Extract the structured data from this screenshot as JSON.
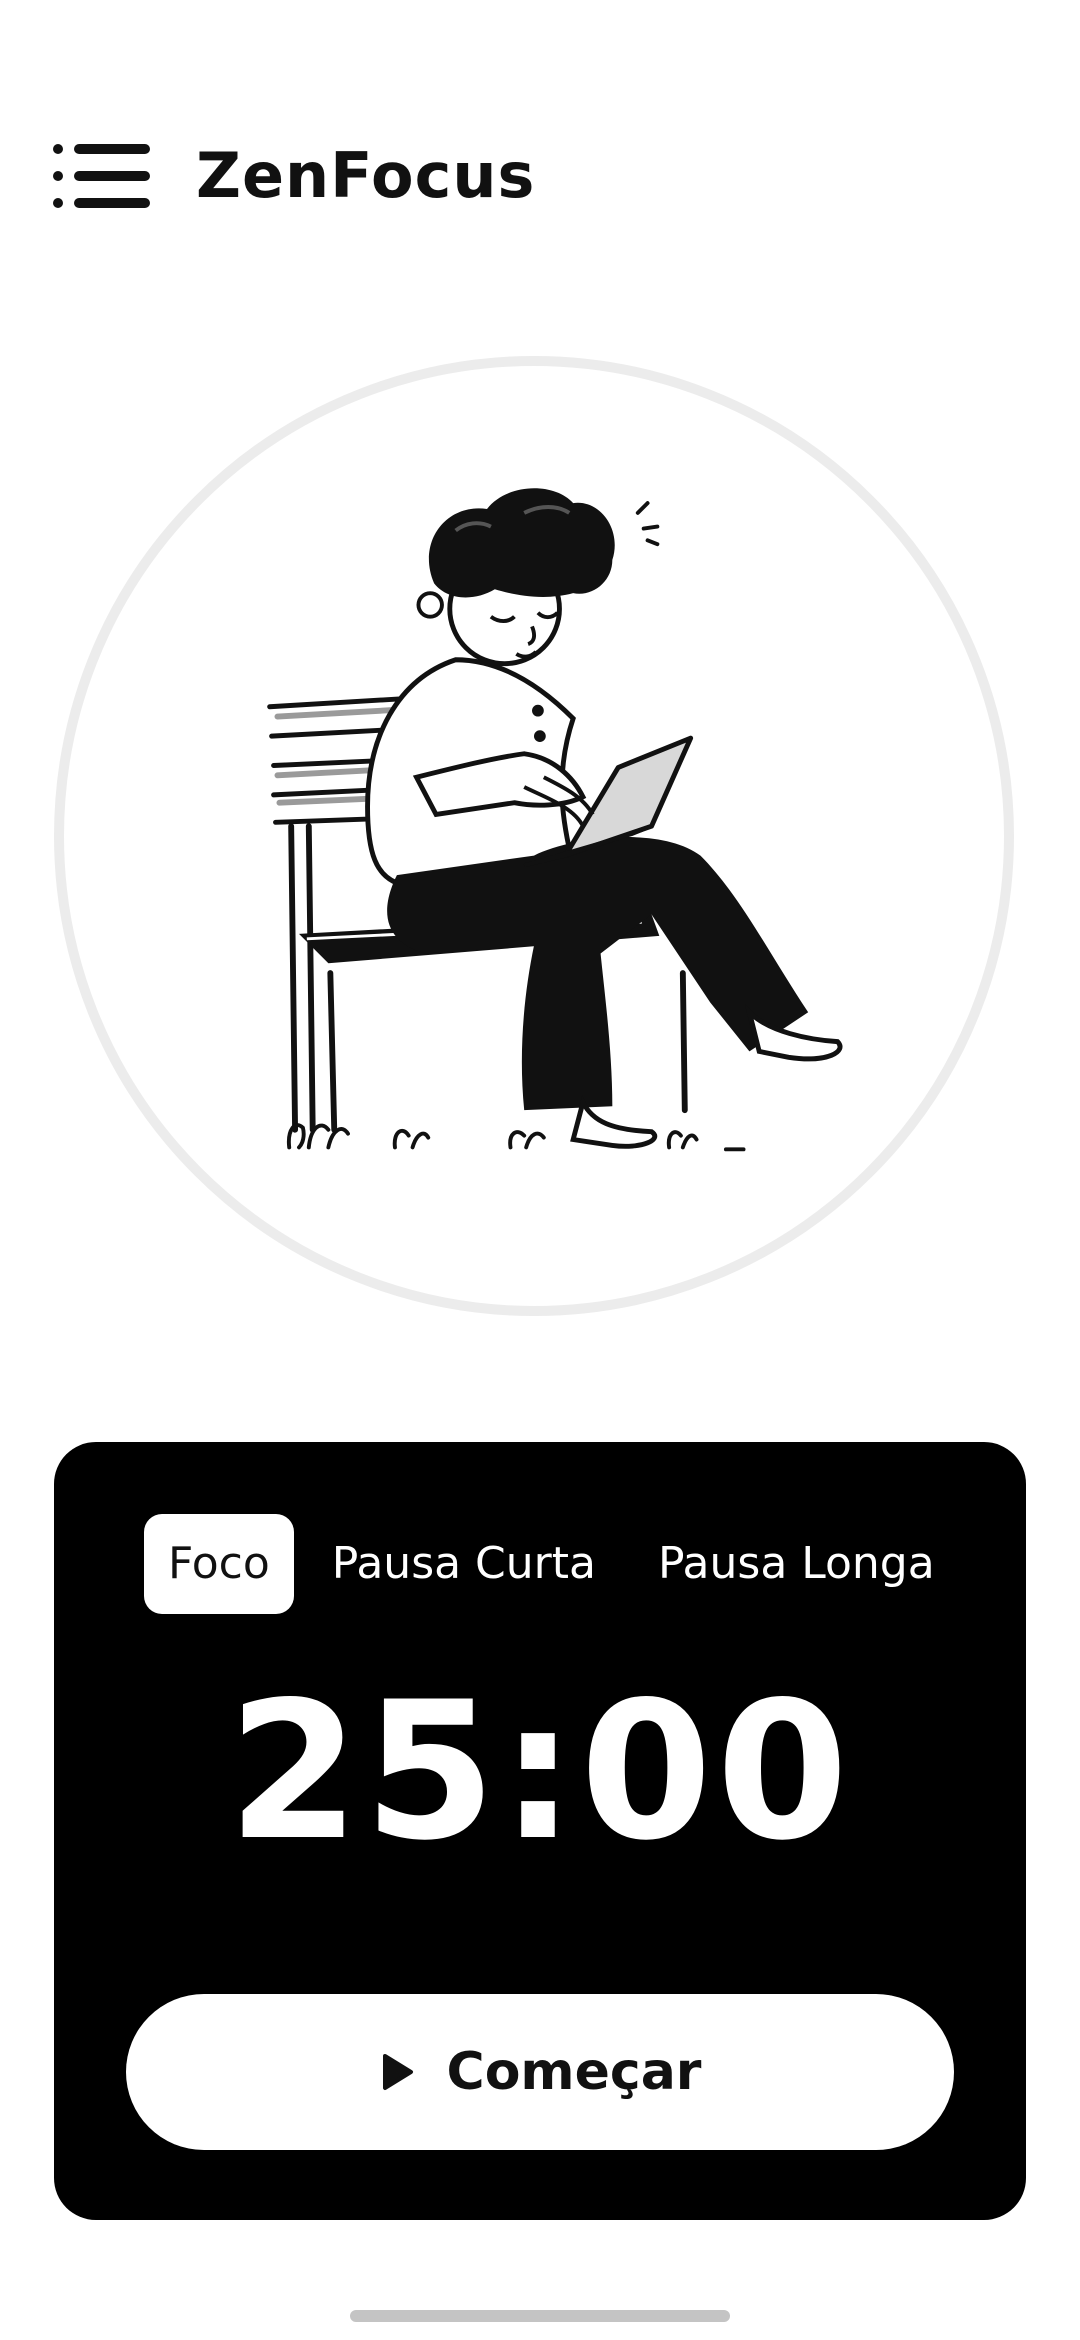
{
  "header": {
    "title": "ZenFocus",
    "menu_icon": "menu-list-icon"
  },
  "illustration": {
    "icon": "person-on-bench-with-laptop-illustration"
  },
  "timer": {
    "tabs": [
      {
        "label": "Foco",
        "active": true
      },
      {
        "label": "Pausa Curta",
        "active": false
      },
      {
        "label": "Pausa Longa",
        "active": false
      }
    ],
    "time": "25:00",
    "start_label": "Começar",
    "start_icon": "play-icon"
  },
  "colors": {
    "background": "#ffffff",
    "card": "#000000",
    "circle_border": "#ececec",
    "text": "#111111"
  }
}
